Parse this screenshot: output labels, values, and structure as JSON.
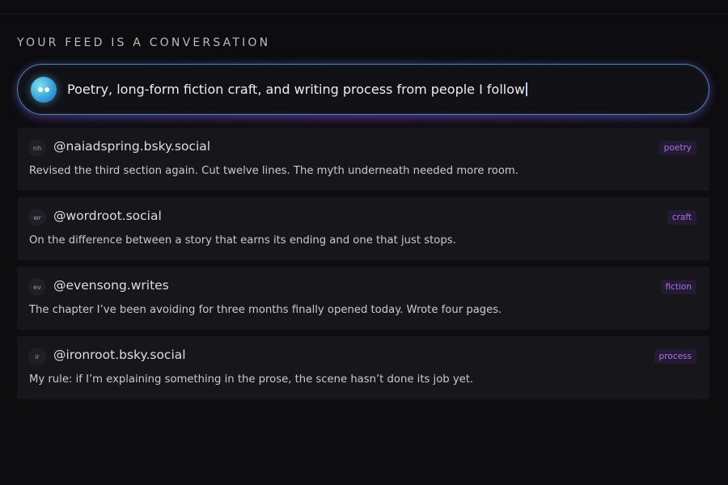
{
  "feed": {
    "heading": "YOUR FEED IS A CONVERSATION",
    "prompt_value": "Poetry, long-form fiction craft, and writing process from people I follow",
    "assistant_icon": "assistant-face-icon"
  },
  "posts": [
    {
      "avatar": "nh",
      "handle": "@naiadspring.bsky.social",
      "tag": "poetry",
      "text": "Revised the third section again. Cut twelve lines. The myth underneath needed more room."
    },
    {
      "avatar": "wr",
      "handle": "@wordroot.social",
      "tag": "craft",
      "text": "On the difference between a story that earns its ending and one that just stops."
    },
    {
      "avatar": "ev",
      "handle": "@evensong.writes",
      "tag": "fiction",
      "text": "The chapter I’ve been avoiding for three months finally opened today. Wrote four pages."
    },
    {
      "avatar": "ir",
      "handle": "@ironroot.bsky.social",
      "tag": "process",
      "text": "My rule: if I’m explaining something in the prose, the scene hasn’t done its job yet."
    }
  ],
  "colors": {
    "background": "#0d0d0f",
    "card": "#17171b",
    "tag_bg": "#241a33",
    "tag_text": "#a577d8",
    "prompt_border": "#5a7fb2",
    "assistant_accent": "#3aa3d8"
  }
}
